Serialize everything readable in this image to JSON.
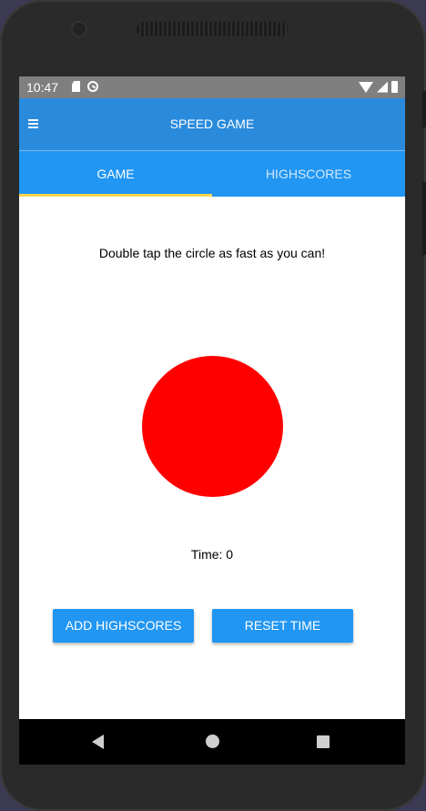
{
  "status_bar": {
    "time": "10:47",
    "icons_left": [
      "sd-card-icon",
      "sync-icon"
    ],
    "icons_right": [
      "wifi-icon",
      "signal-icon",
      "battery-icon"
    ]
  },
  "app_bar": {
    "title": "SPEED GAME",
    "menu_icon": "hamburger-menu-icon",
    "color": "#2a8bdc"
  },
  "tabs": [
    {
      "label": "GAME",
      "active": true
    },
    {
      "label": "HIGHSCORES",
      "active": false
    }
  ],
  "tab_indicator_color": "#ffd54f",
  "game": {
    "instruction": "Double tap the circle as fast as you can!",
    "circle_color": "#ff0000",
    "time_label": "Time: 0"
  },
  "buttons": {
    "add_highscores": "ADD HIGHSCORES",
    "reset_time": "RESET TIME",
    "color": "#2196f3"
  },
  "nav_bar": {
    "icons": [
      "back-icon",
      "home-icon",
      "recents-icon"
    ]
  }
}
